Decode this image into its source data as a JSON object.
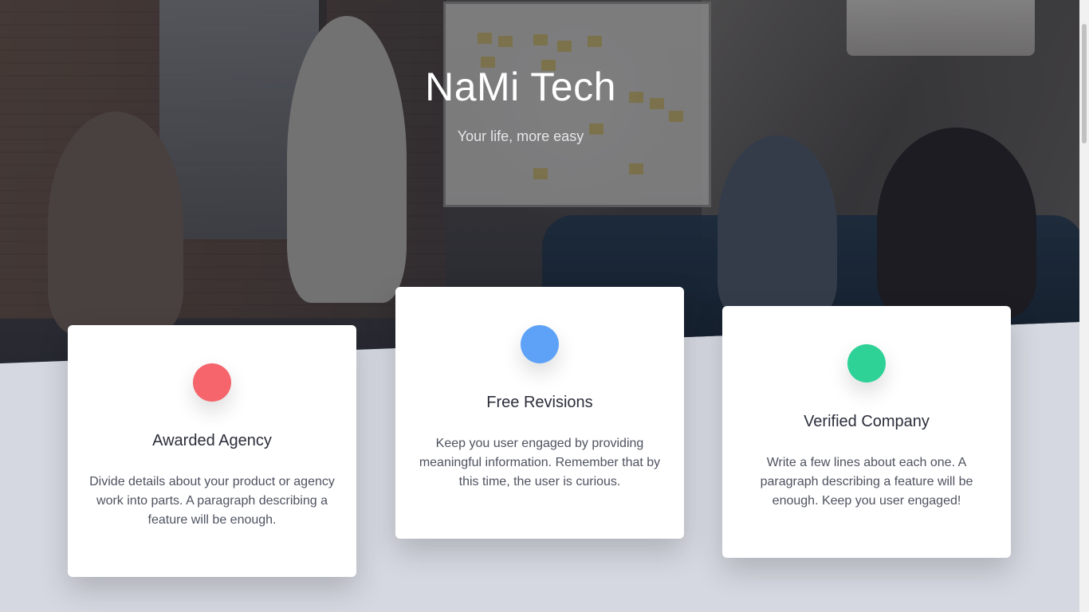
{
  "hero": {
    "title": "NaMi Tech",
    "subtitle": "Your life, more easy"
  },
  "features": [
    {
      "icon": "red-circle-icon",
      "color": "#f5656b",
      "title": "Awarded Agency",
      "description": "Divide details about your product or agency work into parts. A paragraph describing a feature will be enough."
    },
    {
      "icon": "blue-circle-icon",
      "color": "#5ea2f7",
      "title": "Free Revisions",
      "description": "Keep you user engaged by providing meaningful information. Remember that by this time, the user is curious."
    },
    {
      "icon": "green-circle-icon",
      "color": "#2fd296",
      "title": "Verified Company",
      "description": "Write a few lines about each one. A paragraph describing a feature will be enough. Keep you user engaged!"
    }
  ]
}
